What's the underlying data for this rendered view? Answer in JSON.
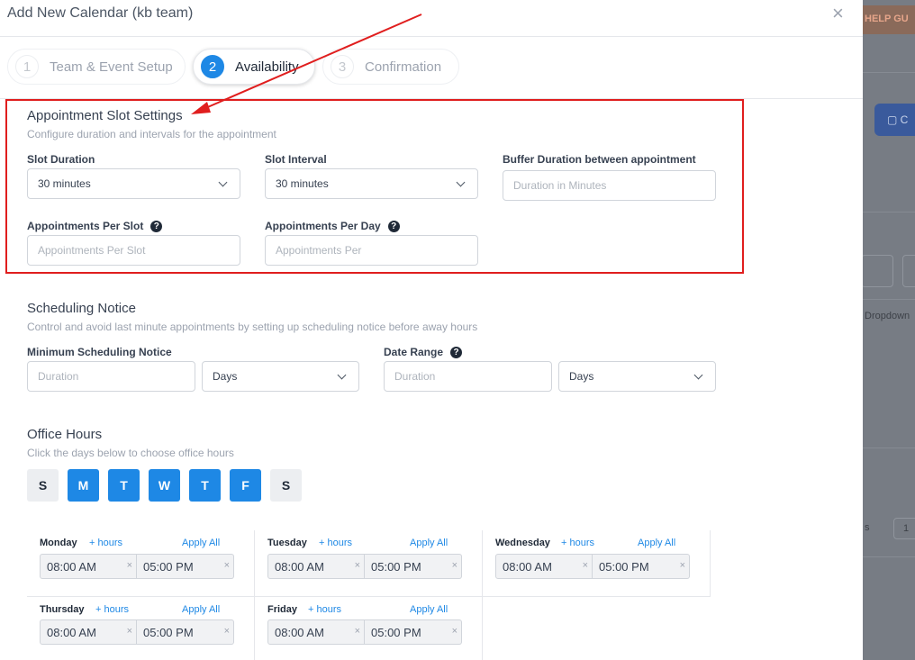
{
  "backdrop": {
    "help_text": "HELP GU",
    "button_label": "C",
    "dropdown_text": "Dropdown",
    "item_text": "s",
    "pager_text": "1"
  },
  "modal": {
    "title": "Add New Calendar (kb team)",
    "close_icon": "close-icon"
  },
  "steps": [
    {
      "num": "1",
      "label": "Team & Event Setup",
      "active": false
    },
    {
      "num": "2",
      "label": "Availability",
      "active": true
    },
    {
      "num": "3",
      "label": "Confirmation",
      "active": false
    }
  ],
  "slot_settings": {
    "title": "Appointment Slot Settings",
    "subtitle": "Configure duration and intervals for the appointment",
    "slot_duration_label": "Slot Duration",
    "slot_duration_value": "30 minutes",
    "slot_interval_label": "Slot Interval",
    "slot_interval_value": "30 minutes",
    "buffer_label": "Buffer Duration between appointment",
    "buffer_placeholder": "Duration in Minutes",
    "per_slot_label": "Appointments Per Slot",
    "per_slot_placeholder": "Appointments Per Slot",
    "per_day_label": "Appointments Per Day",
    "per_day_placeholder": "Appointments Per"
  },
  "scheduling": {
    "title": "Scheduling Notice",
    "subtitle": "Control and avoid last minute appointments by setting up scheduling notice before away hours",
    "min_notice_label": "Minimum Scheduling Notice",
    "min_notice_placeholder": "Duration",
    "min_notice_unit": "Days",
    "date_range_label": "Date Range",
    "date_range_placeholder": "Duration",
    "date_range_unit": "Days"
  },
  "office_hours": {
    "title": "Office Hours",
    "subtitle": "Click the days below to choose office hours",
    "days": [
      {
        "letter": "S",
        "active": false
      },
      {
        "letter": "M",
        "active": true
      },
      {
        "letter": "T",
        "active": true
      },
      {
        "letter": "W",
        "active": true
      },
      {
        "letter": "T",
        "active": true
      },
      {
        "letter": "F",
        "active": true
      },
      {
        "letter": "S",
        "active": false
      }
    ],
    "add_hours_label": "+ hours",
    "apply_all_label": "Apply All",
    "clear_glyph": "×",
    "schedule": [
      {
        "day": "Monday",
        "start": "08:00 AM",
        "end": "05:00 PM"
      },
      {
        "day": "Tuesday",
        "start": "08:00 AM",
        "end": "05:00 PM"
      },
      {
        "day": "Wednesday",
        "start": "08:00 AM",
        "end": "05:00 PM"
      },
      {
        "day": "Thursday",
        "start": "08:00 AM",
        "end": "05:00 PM"
      },
      {
        "day": "Friday",
        "start": "08:00 AM",
        "end": "05:00 PM"
      }
    ]
  },
  "help_icon": "?",
  "colors": {
    "accent": "#1e88e5",
    "annotation": "#e01e1e"
  }
}
